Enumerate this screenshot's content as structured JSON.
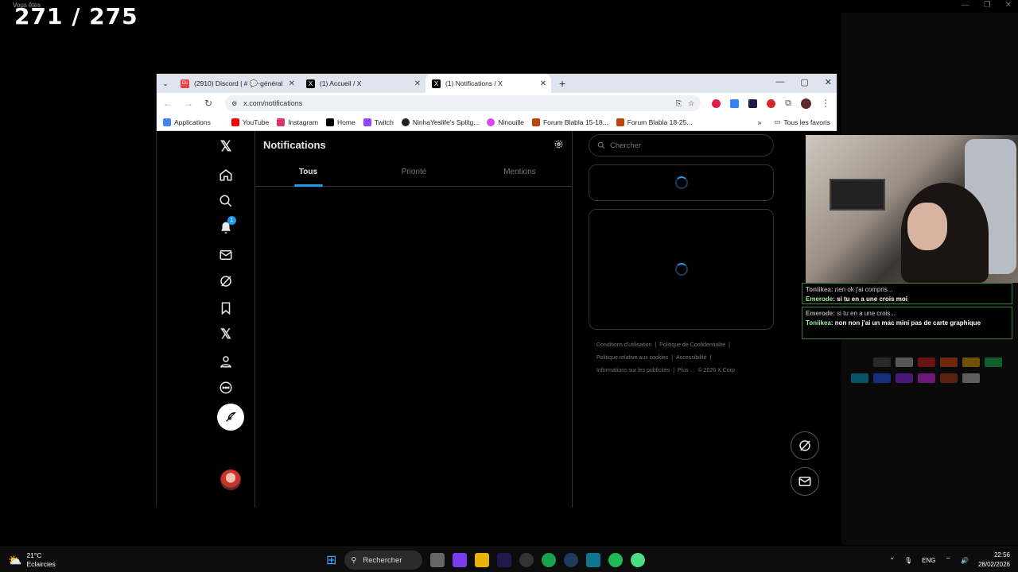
{
  "stream": {
    "counter": "271 / 275",
    "tag": "Vous êtes"
  },
  "browser": {
    "tabs": [
      {
        "title": "(2910) Discord | # 💬-général |",
        "favicon_color": "#ed4245",
        "favicon": "Dc"
      },
      {
        "title": "(1) Accueil / X",
        "favicon_color": "#000000",
        "favicon": "X"
      },
      {
        "title": "(1) Notifications / X",
        "favicon_color": "#000000",
        "favicon": "X"
      }
    ],
    "url": "x.com/notifications",
    "bookmarks": [
      {
        "label": "Applications",
        "color": "#4285f4"
      },
      {
        "label": "YouTube",
        "color": "#ff0000"
      },
      {
        "label": "Instagram",
        "color": "#e1306c"
      },
      {
        "label": "Home",
        "color": "#000000"
      },
      {
        "label": "Twitch",
        "color": "#9146ff"
      },
      {
        "label": "NinhaYeslife's Splitg...",
        "color": "#222222"
      },
      {
        "label": "Ninouille",
        "color": "#d946ef"
      },
      {
        "label": "Forum Blabla 15-18...",
        "color": "#c2410c"
      },
      {
        "label": "Forum Blabla 18-25...",
        "color": "#c2410c"
      }
    ],
    "all_favorites": "Tous les favoris"
  },
  "x": {
    "notif_badge": "1",
    "page_title": "Notifications",
    "tabs": [
      "Tous",
      "Priorité",
      "Mentions"
    ],
    "search_placeholder": "Chercher",
    "footer": [
      "Conditions d'utilisation",
      "|",
      "Politique de Confidentialité",
      "|",
      "Politique relative aux cookies",
      "|",
      "Accessibilité",
      "|",
      "Informations sur les publicités",
      "|",
      "Plus ...",
      "© 2026 X Corp."
    ],
    "accent": "#1d9bf0"
  },
  "chat": [
    {
      "reply_user": "Toniikea:",
      "reply_text": "rien ok j'ai compris...",
      "user": "Emerode",
      "text": ": si tu en a une crois moi"
    },
    {
      "reply_user": "Emerode:",
      "reply_text": "si tu en a une crois...",
      "user": "Toniikea",
      "text": ": non non j'ai un mac mini pas de carte graphique"
    }
  ],
  "taskbar": {
    "temperature": "21°C",
    "weather": "Eclaircies",
    "search": "Rechercher",
    "lang": "ENG",
    "time": "22:56",
    "date": "28/02/2026"
  }
}
